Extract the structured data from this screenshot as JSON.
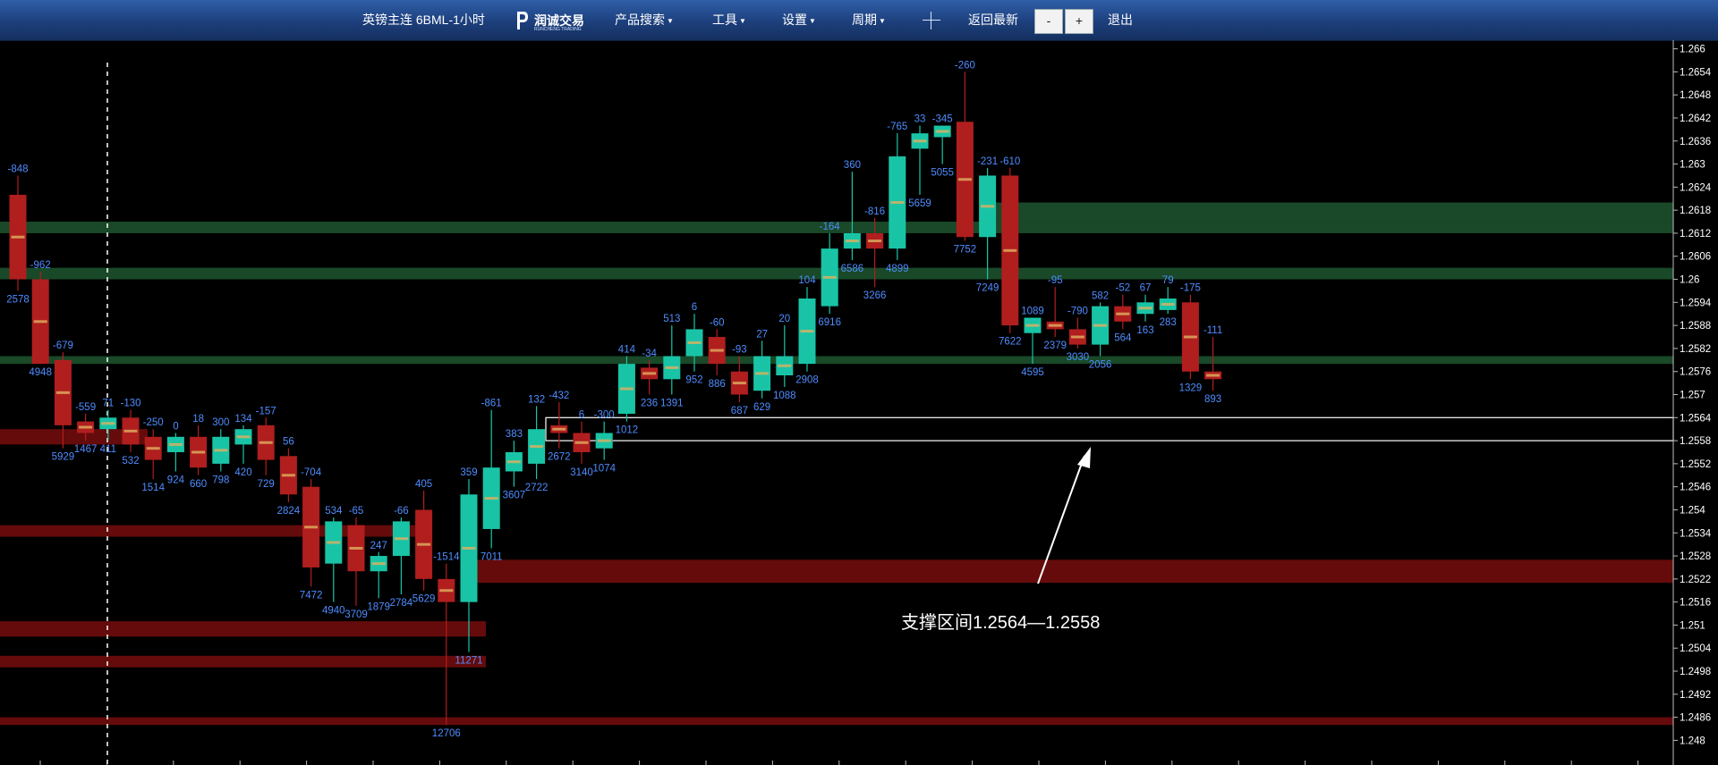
{
  "toolbar": {
    "title": "英镑主连 6BML-1小时",
    "logo_text": "润诚交易",
    "logo_sub": "RUNCHENG TRADING",
    "product_search": "产品搜索",
    "tools": "工具",
    "settings": "设置",
    "period": "周期",
    "back_latest": "返回最新",
    "zoom_out": "-",
    "zoom_in": "+",
    "logout": "退出"
  },
  "annotation": "支撑区间1.2564—1.2558",
  "colors": {
    "up": "#19c4a6",
    "down": "#b01e1e",
    "label": "#4f8cff",
    "support": "#1a4d2a",
    "resistance": "#6a0c0c"
  },
  "chart_data": {
    "type": "candlestick",
    "ylim": [
      1.2478,
      1.2662
    ],
    "y_ticks": [
      "1.248",
      "1.2486",
      "1.2492",
      "1.2498",
      "1.2504",
      "1.251",
      "1.2516",
      "1.2522",
      "1.2528",
      "1.2534",
      "1.254",
      "1.2546",
      "1.2552",
      "1.2558",
      "1.2564",
      "1.257",
      "1.2576",
      "1.2582",
      "1.2588",
      "1.2594",
      "1.26",
      "1.2606",
      "1.2612",
      "1.2618",
      "1.2624",
      "1.263",
      "1.2636",
      "1.2642",
      "1.2648",
      "1.2654",
      "1.266"
    ],
    "candles": [
      {
        "o": 1.2622,
        "h": 1.2627,
        "l": 1.2597,
        "c": 1.26,
        "top": "-848",
        "bot": "2578"
      },
      {
        "o": 1.26,
        "h": 1.2602,
        "l": 1.2578,
        "c": 1.2578,
        "top": "-962",
        "bot": "4948"
      },
      {
        "o": 1.2579,
        "h": 1.2581,
        "l": 1.2556,
        "c": 1.2562,
        "top": "-679",
        "bot": "5929"
      },
      {
        "o": 1.2563,
        "h": 1.2565,
        "l": 1.2558,
        "c": 1.256,
        "top": "-559",
        "bot": "1467"
      },
      {
        "o": 1.2561,
        "h": 1.2566,
        "l": 1.2558,
        "c": 1.2564,
        "top": "71",
        "bot": "411"
      },
      {
        "o": 1.2564,
        "h": 1.2566,
        "l": 1.2555,
        "c": 1.2557,
        "top": "-130",
        "bot": "532"
      },
      {
        "o": 1.2559,
        "h": 1.2561,
        "l": 1.2548,
        "c": 1.2553,
        "top": "-250",
        "bot": "1514"
      },
      {
        "o": 1.2555,
        "h": 1.256,
        "l": 1.255,
        "c": 1.2559,
        "top": "0",
        "bot": "924"
      },
      {
        "o": 1.2559,
        "h": 1.2562,
        "l": 1.2549,
        "c": 1.2551,
        "top": "18",
        "bot": "660"
      },
      {
        "o": 1.2552,
        "h": 1.2561,
        "l": 1.255,
        "c": 1.2559,
        "top": "300",
        "bot": "798"
      },
      {
        "o": 1.2557,
        "h": 1.2562,
        "l": 1.2552,
        "c": 1.2561,
        "top": "134",
        "bot": "420"
      },
      {
        "o": 1.2562,
        "h": 1.2564,
        "l": 1.2549,
        "c": 1.2553,
        "top": "-157",
        "bot": "729"
      },
      {
        "o": 1.2554,
        "h": 1.2556,
        "l": 1.2542,
        "c": 1.2544,
        "top": "56",
        "bot": "2824"
      },
      {
        "o": 1.2546,
        "h": 1.2548,
        "l": 1.252,
        "c": 1.2525,
        "top": "-704",
        "bot": "7472"
      },
      {
        "o": 1.2526,
        "h": 1.2538,
        "l": 1.2516,
        "c": 1.2537,
        "top": "534",
        "bot": "4940"
      },
      {
        "o": 1.2536,
        "h": 1.2538,
        "l": 1.2515,
        "c": 1.2524,
        "top": "-65",
        "bot": "3709"
      },
      {
        "o": 1.2524,
        "h": 1.2529,
        "l": 1.2517,
        "c": 1.2528,
        "top": "247",
        "bot": "1879"
      },
      {
        "o": 1.2528,
        "h": 1.2538,
        "l": 1.2518,
        "c": 1.2537,
        "top": "-66",
        "bot": "2784"
      },
      {
        "o": 1.254,
        "h": 1.2545,
        "l": 1.2519,
        "c": 1.2522,
        "top": "405",
        "bot": "5629"
      },
      {
        "o": 1.2522,
        "h": 1.2526,
        "l": 1.2484,
        "c": 1.2516,
        "top": "-1514",
        "bot": "12706"
      },
      {
        "o": 1.2516,
        "h": 1.2548,
        "l": 1.2503,
        "c": 1.2544,
        "top": "359",
        "bot": "11271"
      },
      {
        "o": 1.2535,
        "h": 1.2566,
        "l": 1.253,
        "c": 1.2551,
        "top": "-861",
        "bot": "7011"
      },
      {
        "o": 1.255,
        "h": 1.2558,
        "l": 1.2546,
        "c": 1.2555,
        "top": "383",
        "bot": "3607"
      },
      {
        "o": 1.2552,
        "h": 1.2567,
        "l": 1.2548,
        "c": 1.2561,
        "top": "132",
        "bot": "2722"
      },
      {
        "o": 1.2562,
        "h": 1.2568,
        "l": 1.2556,
        "c": 1.256,
        "top": "-432",
        "bot": "2672"
      },
      {
        "o": 1.256,
        "h": 1.2563,
        "l": 1.2552,
        "c": 1.2555,
        "top": "6",
        "bot": "3140"
      },
      {
        "o": 1.2556,
        "h": 1.2563,
        "l": 1.2553,
        "c": 1.256,
        "top": "-300",
        "bot": "1074"
      },
      {
        "o": 1.2565,
        "h": 1.258,
        "l": 1.2563,
        "c": 1.2578,
        "top": "414",
        "bot": "1012"
      },
      {
        "o": 1.2577,
        "h": 1.2579,
        "l": 1.257,
        "c": 1.2574,
        "top": "-34",
        "bot": "236"
      },
      {
        "o": 1.2574,
        "h": 1.2588,
        "l": 1.257,
        "c": 1.258,
        "top": "513",
        "bot": "1391"
      },
      {
        "o": 1.258,
        "h": 1.2591,
        "l": 1.2576,
        "c": 1.2587,
        "top": "6",
        "bot": "952"
      },
      {
        "o": 1.2585,
        "h": 1.2587,
        "l": 1.2575,
        "c": 1.2578,
        "top": "-60",
        "bot": "886"
      },
      {
        "o": 1.2576,
        "h": 1.258,
        "l": 1.2568,
        "c": 1.257,
        "top": "-93",
        "bot": "687"
      },
      {
        "o": 1.2571,
        "h": 1.2584,
        "l": 1.2569,
        "c": 1.258,
        "top": "27",
        "bot": "629"
      },
      {
        "o": 1.2575,
        "h": 1.2588,
        "l": 1.2572,
        "c": 1.258,
        "top": "20",
        "bot": "1088"
      },
      {
        "o": 1.2578,
        "h": 1.2598,
        "l": 1.2576,
        "c": 1.2595,
        "top": "104",
        "bot": "2908"
      },
      {
        "o": 1.2593,
        "h": 1.2612,
        "l": 1.2591,
        "c": 1.2608,
        "top": "-164",
        "bot": "6916"
      },
      {
        "o": 1.2608,
        "h": 1.2628,
        "l": 1.2605,
        "c": 1.2612,
        "top": "360",
        "bot": "6586"
      },
      {
        "o": 1.2612,
        "h": 1.2616,
        "l": 1.2598,
        "c": 1.2608,
        "top": "-816",
        "bot": "3266"
      },
      {
        "o": 1.2608,
        "h": 1.2638,
        "l": 1.2605,
        "c": 1.2632,
        "top": "-765",
        "bot": "4899"
      },
      {
        "o": 1.2634,
        "h": 1.264,
        "l": 1.2622,
        "c": 1.2638,
        "top": "33",
        "bot": "5659"
      },
      {
        "o": 1.2637,
        "h": 1.264,
        "l": 1.263,
        "c": 1.264,
        "top": "-345",
        "bot": "5055"
      },
      {
        "o": 1.2641,
        "h": 1.2654,
        "l": 1.261,
        "c": 1.2611,
        "top": "-260",
        "bot": "7752"
      },
      {
        "o": 1.2611,
        "h": 1.2629,
        "l": 1.26,
        "c": 1.2627,
        "top": "-231",
        "bot": "7249"
      },
      {
        "o": 1.2627,
        "h": 1.2629,
        "l": 1.2586,
        "c": 1.2588,
        "top": "-610",
        "bot": "7622"
      },
      {
        "o": 1.2586,
        "h": 1.259,
        "l": 1.2578,
        "c": 1.259,
        "top": "1089",
        "bot": "4595"
      },
      {
        "o": 1.2589,
        "h": 1.2598,
        "l": 1.2585,
        "c": 1.2587,
        "top": "-95",
        "bot": "2379"
      },
      {
        "o": 1.2587,
        "h": 1.259,
        "l": 1.2582,
        "c": 1.2583,
        "top": "-790",
        "bot": "3030"
      },
      {
        "o": 1.2583,
        "h": 1.2594,
        "l": 1.258,
        "c": 1.2593,
        "top": "582",
        "bot": "2056"
      },
      {
        "o": 1.2593,
        "h": 1.2596,
        "l": 1.2587,
        "c": 1.2589,
        "top": "-52",
        "bot": "564"
      },
      {
        "o": 1.2591,
        "h": 1.2596,
        "l": 1.2589,
        "c": 1.2594,
        "top": "67",
        "bot": "163"
      },
      {
        "o": 1.2592,
        "h": 1.2598,
        "l": 1.2591,
        "c": 1.2595,
        "top": "79",
        "bot": "283"
      },
      {
        "o": 1.2594,
        "h": 1.2596,
        "l": 1.2574,
        "c": 1.2576,
        "top": "-175",
        "bot": "1329"
      },
      {
        "o": 1.2576,
        "h": 1.2585,
        "l": 1.2571,
        "c": 1.2574,
        "top": "-111",
        "bot": "893"
      }
    ],
    "zones": [
      {
        "kind": "support",
        "y1": 1.2612,
        "y2": 1.2615,
        "to": -1
      },
      {
        "kind": "support",
        "y1": 1.26,
        "y2": 1.2603,
        "to": -1
      },
      {
        "kind": "support",
        "y1": 1.2578,
        "y2": 1.258,
        "to": -1
      },
      {
        "kind": "support",
        "y1": 1.2615,
        "y2": 1.262,
        "from": 44
      },
      {
        "kind": "resistance",
        "y1": 1.2557,
        "y2": 1.2561,
        "to": 5
      },
      {
        "kind": "resistance",
        "y1": 1.2533,
        "y2": 1.2536,
        "to": 17
      },
      {
        "kind": "resistance",
        "y1": 1.2521,
        "y2": 1.2527,
        "from": 21
      },
      {
        "kind": "resistance",
        "y1": 1.2507,
        "y2": 1.2511,
        "to": 20
      },
      {
        "kind": "resistance",
        "y1": 1.2499,
        "y2": 1.2502,
        "to": 20
      },
      {
        "kind": "resistance",
        "y1": 1.2484,
        "y2": 1.2486,
        "to": -1
      }
    ],
    "support_box": [
      1.2558,
      1.2564
    ]
  }
}
